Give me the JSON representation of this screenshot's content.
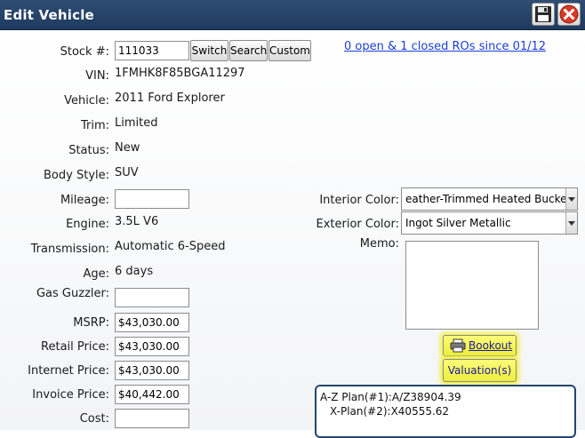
{
  "window": {
    "title": "Edit Vehicle",
    "save_icon": "floppy-disk-icon",
    "close_icon": "red-x-close-icon"
  },
  "stock": {
    "label": "Stock #:",
    "value": "111033",
    "buttons": [
      "Switch",
      "Search",
      "Custom"
    ]
  },
  "ro_link": "0 open & 1 closed ROs since 01/12",
  "fields": {
    "vin": {
      "label": "VIN:",
      "value": "1FMHK8F85BGA11297"
    },
    "vehicle": {
      "label": "Vehicle:",
      "value": "2011 Ford Explorer"
    },
    "trim": {
      "label": "Trim:",
      "value": "Limited"
    },
    "status": {
      "label": "Status:",
      "value": "New"
    },
    "body_style": {
      "label": "Body Style:",
      "value": "SUV"
    },
    "mileage": {
      "label": "Mileage:",
      "value": ""
    },
    "engine": {
      "label": "Engine:",
      "value": "3.5L V6"
    },
    "transmission": {
      "label": "Transmission:",
      "value": "Automatic 6-Speed"
    },
    "age": {
      "label": "Age:",
      "value": "6 days"
    },
    "gas_guzzler": {
      "label": "Gas Guzzler:",
      "value": ""
    },
    "msrp": {
      "label": "MSRP:",
      "value": "$43,030.00"
    },
    "retail_price": {
      "label": "Retail Price:",
      "value": "$43,030.00"
    },
    "internet_price": {
      "label": "Internet Price:",
      "value": "$43,030.00"
    },
    "invoice_price": {
      "label": "Invoice Price:",
      "value": "$40,442.00"
    },
    "cost": {
      "label": "Cost:",
      "value": ""
    }
  },
  "interior_color": {
    "label": "Interior Color:",
    "value": "eather-Trimmed Heated Bucket"
  },
  "exterior_color": {
    "label": "Exterior Color:",
    "value": "Ingot Silver Metallic"
  },
  "memo": {
    "label": "Memo:",
    "value": ""
  },
  "buttons": {
    "bookout": "Bookout",
    "valuations": "Valuation(s)"
  },
  "plans": [
    "A-Z Plan(#1):A/Z38904.39",
    "X-Plan(#2):X40555.62"
  ],
  "colors": {
    "titlebar": "#1e3a5f",
    "link": "#1a3fd6",
    "highlight": "#f2f24a"
  }
}
